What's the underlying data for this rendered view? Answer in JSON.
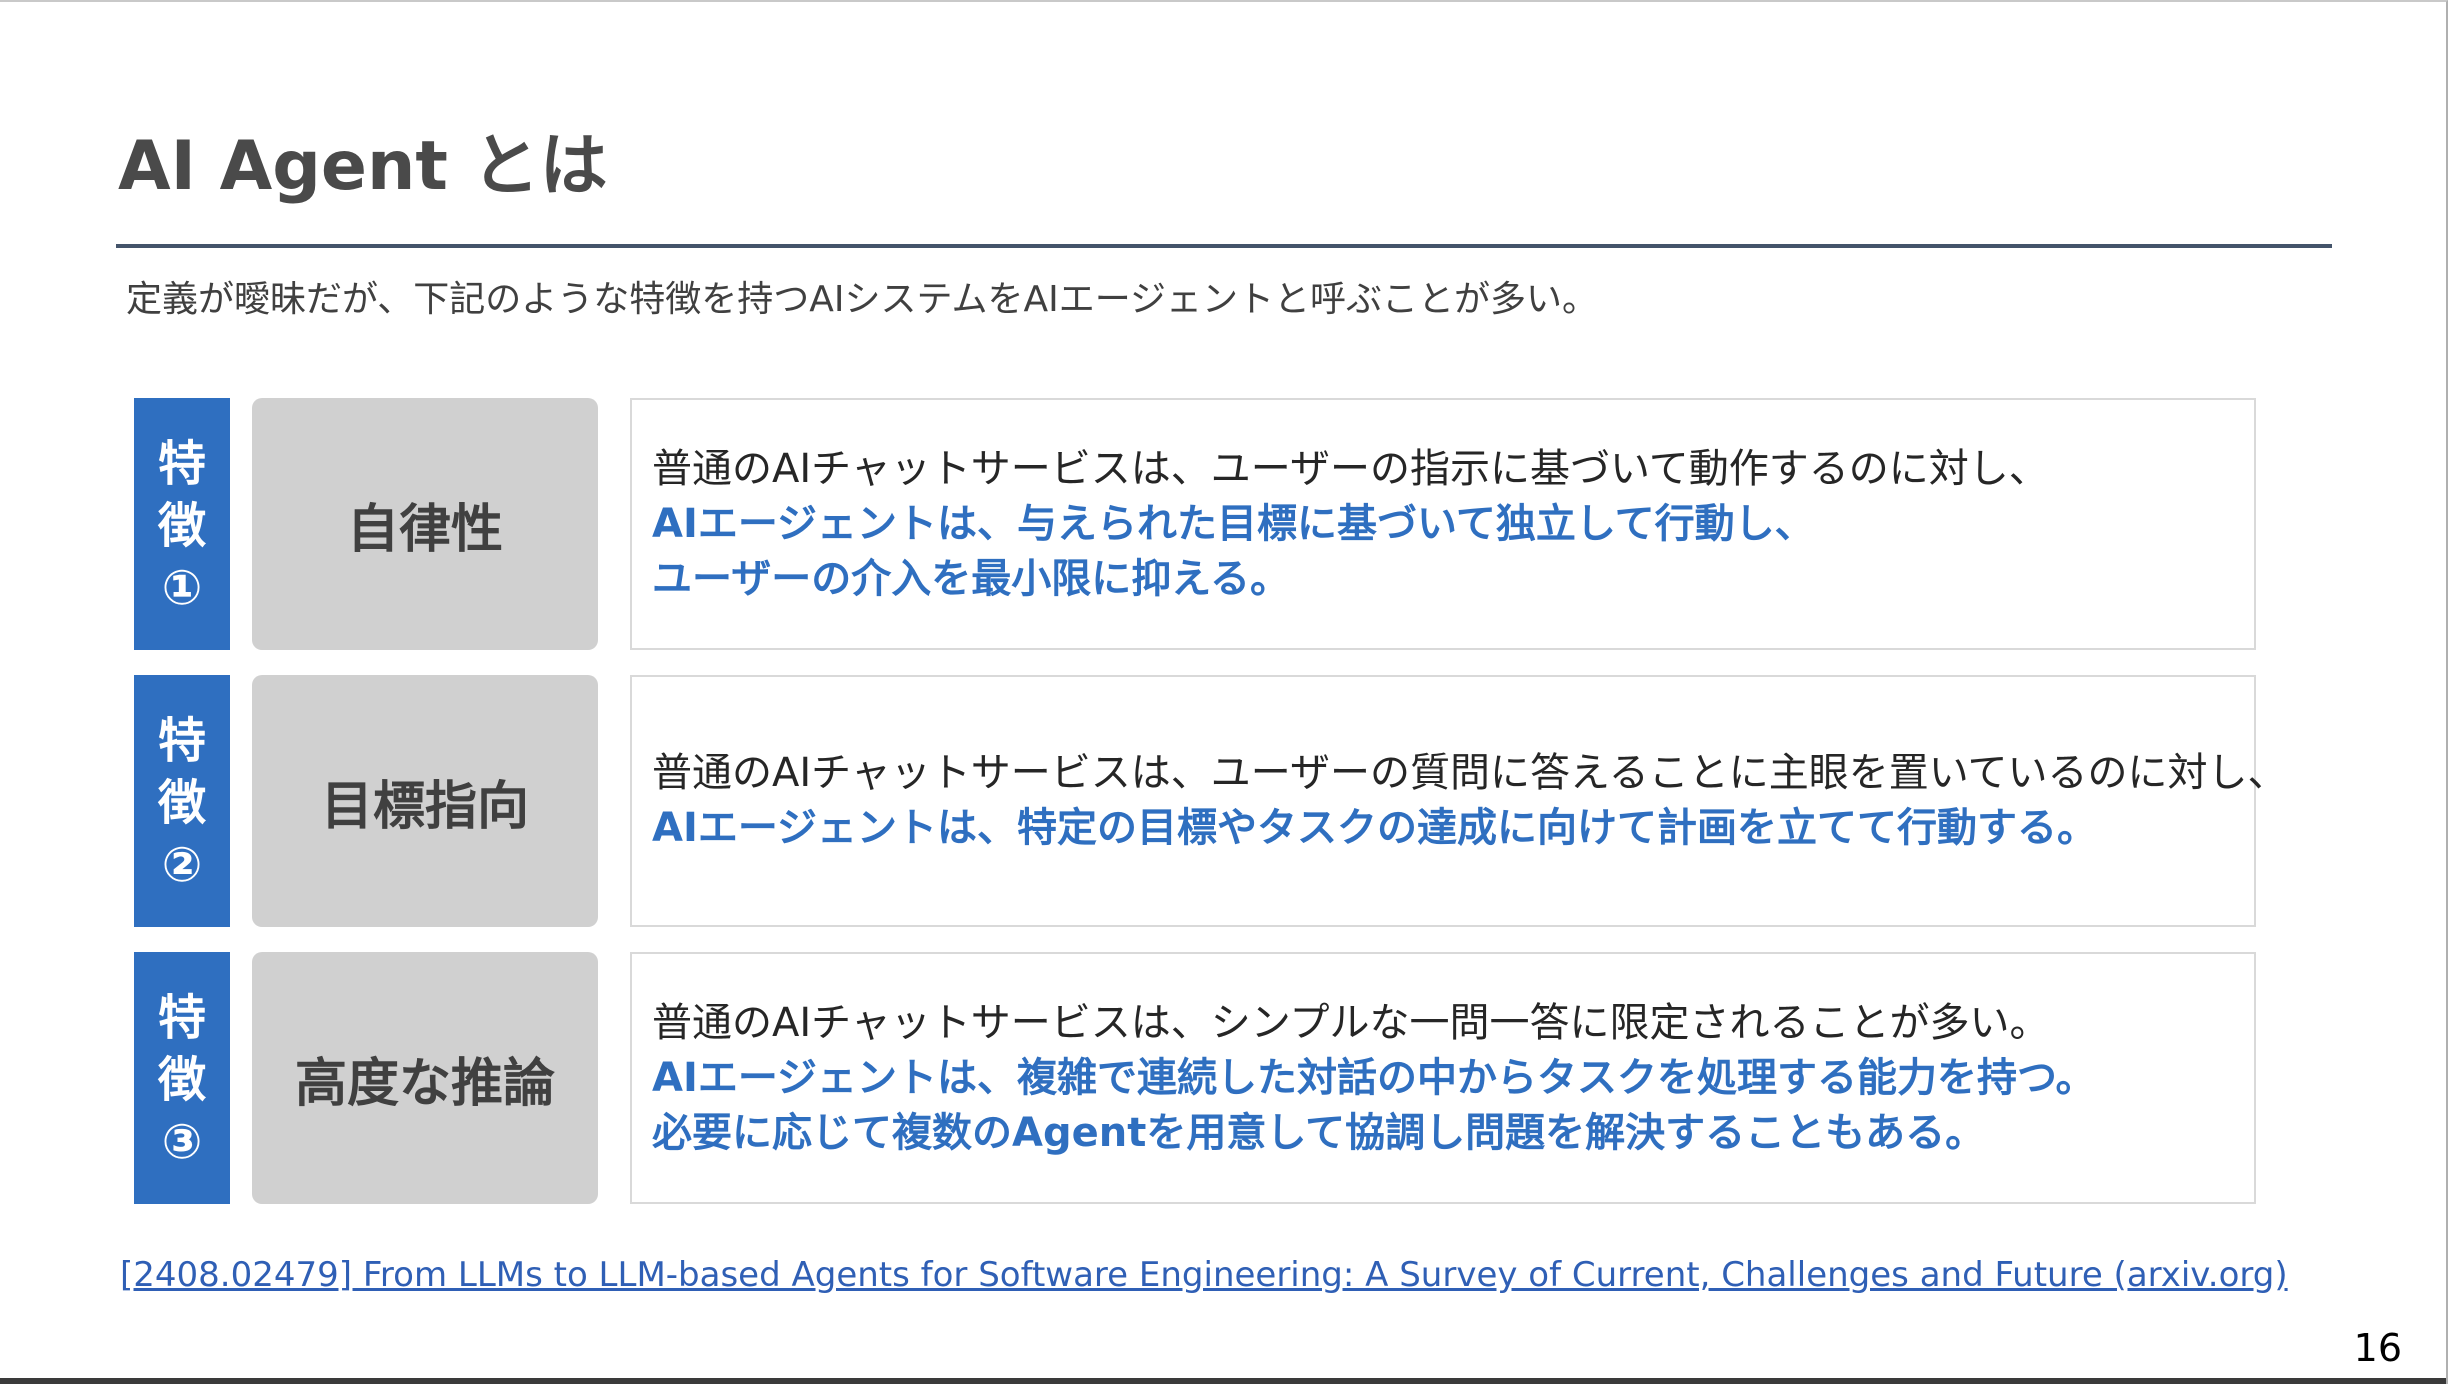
{
  "slide": {
    "title": "AI Agent とは",
    "subtitle": "定義が曖昧だが、下記のような特徴を持つAIシステムをAIエージェントと呼ぶことが多い。",
    "features": [
      {
        "badge": [
          "特",
          "徴",
          "①"
        ],
        "name": "自律性",
        "normal_lines": [
          "普通のAIチャットサービスは、ユーザーの指示に基づいて動作するのに対し、"
        ],
        "highlight_lines": [
          "AIエージェントは、与えられた目標に基づいて独立して行動し、",
          "ユーザーの介入を最小限に抑える。"
        ]
      },
      {
        "badge": [
          "特",
          "徴",
          "②"
        ],
        "name": "目標指向",
        "normal_lines": [
          "普通のAIチャットサービスは、ユーザーの質問に答えることに主眼を置いているのに対し、"
        ],
        "highlight_lines": [
          "AIエージェントは、特定の目標やタスクの達成に向けて計画を立てて行動する。"
        ]
      },
      {
        "badge": [
          "特",
          "徴",
          "③"
        ],
        "name": "高度な推論",
        "normal_lines": [
          "普通のAIチャットサービスは、シンプルな一問一答に限定されることが多い。"
        ],
        "highlight_lines": [
          "AIエージェントは、複雑で連続した対話の中からタスクを処理する能力を持つ。",
          "必要に応じて複数のAgentを用意して協調し問題を解決することもある。"
        ]
      }
    ],
    "reference": "[2408.02479] From LLMs to LLM-based Agents for Software Engineering: A Survey of Current, Challenges and Future (arxiv.org)",
    "page_number": "16"
  },
  "colors": {
    "accent_blue": "#2f6fc0",
    "title_rule": "#44546a",
    "name_box_gray": "#d0d0d0",
    "link_blue": "#2f5fb5"
  }
}
